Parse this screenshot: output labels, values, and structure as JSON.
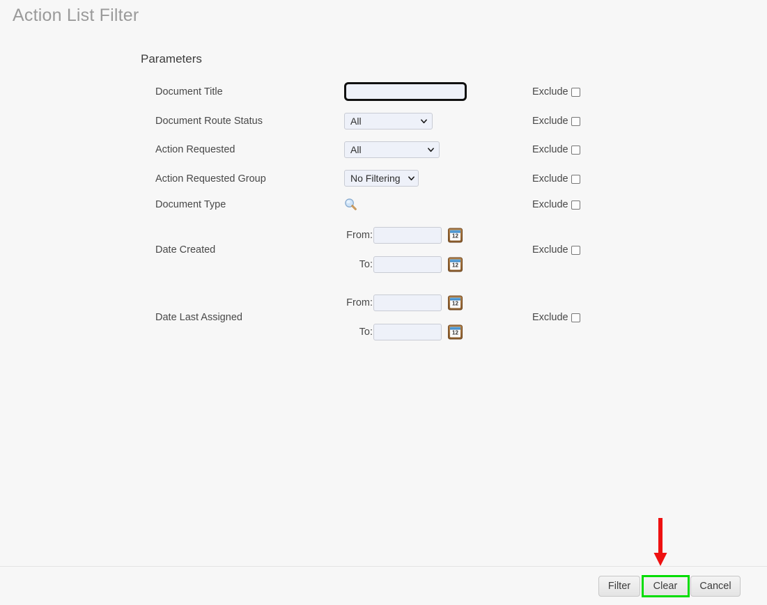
{
  "page": {
    "title": "Action List Filter",
    "section_heading": "Parameters",
    "background_color": "#f7f7f7"
  },
  "form": {
    "exclude_label": "Exclude",
    "fields": [
      {
        "id": "document-title",
        "label": "Document Title",
        "control": "text",
        "value": "",
        "focused": true,
        "exclude_checked": false
      },
      {
        "id": "document-route-status",
        "label": "Document Route Status",
        "control": "select",
        "value": "All",
        "options": [
          "All"
        ],
        "exclude_checked": false
      },
      {
        "id": "action-requested",
        "label": "Action Requested",
        "control": "select",
        "value": "All",
        "options": [
          "All"
        ],
        "exclude_checked": false
      },
      {
        "id": "action-requested-group",
        "label": "Action Requested Group",
        "control": "select",
        "value": "No Filtering",
        "options": [
          "No Filtering"
        ],
        "exclude_checked": false
      },
      {
        "id": "document-type",
        "label": "Document Type",
        "control": "lookup",
        "icon": "magnifier-icon",
        "exclude_checked": false
      },
      {
        "id": "date-created",
        "label": "Date Created",
        "control": "date-range",
        "from_label": "From:",
        "to_label": "To:",
        "from_value": "",
        "to_value": "",
        "calendar_icon_day": "12",
        "exclude_checked": false
      },
      {
        "id": "date-last-assigned",
        "label": "Date Last Assigned",
        "control": "date-range",
        "from_label": "From:",
        "to_label": "To:",
        "from_value": "",
        "to_value": "",
        "calendar_icon_day": "12",
        "exclude_checked": false
      }
    ]
  },
  "footer": {
    "buttons": [
      {
        "id": "filter",
        "label": "Filter"
      },
      {
        "id": "clear",
        "label": "Clear"
      },
      {
        "id": "cancel",
        "label": "Cancel"
      }
    ]
  },
  "annotation": {
    "highlight_target": "clear",
    "highlight_color": "#00dd00",
    "arrow_color": "#ee1111",
    "arrow_direction": "down"
  }
}
